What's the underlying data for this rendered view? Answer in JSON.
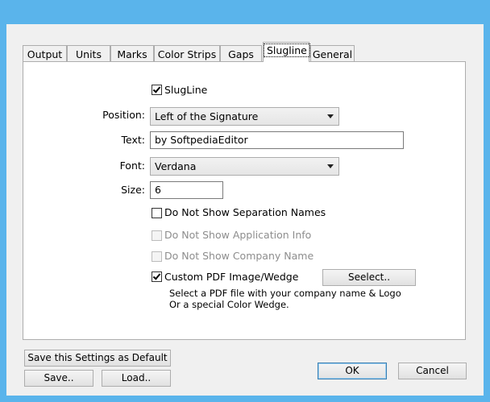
{
  "tabs": [
    {
      "label": "Output",
      "active": false
    },
    {
      "label": "Units",
      "active": false
    },
    {
      "label": "Marks",
      "active": false
    },
    {
      "label": "Color Strips",
      "active": false
    },
    {
      "label": "Gaps",
      "active": false
    },
    {
      "label": "Slugline",
      "active": true
    },
    {
      "label": "General",
      "active": false
    }
  ],
  "slugline": {
    "enable_label": "SlugLine",
    "enable_checked": true,
    "position_label": "Position:",
    "position_value": "Left of the Signature",
    "text_label": "Text:",
    "text_value": "by SoftpediaEditor",
    "font_label": "Font:",
    "font_value": "Verdana",
    "size_label": "Size:",
    "size_value": "6",
    "no_sep_names_label": "Do Not Show Separation Names",
    "no_sep_names_checked": false,
    "no_app_info_label": "Do Not Show Application Info",
    "no_app_info_checked": false,
    "no_company_label": "Do Not Show Company Name",
    "no_company_checked": false,
    "custom_pdf_label": "Custom PDF Image/Wedge",
    "custom_pdf_checked": true,
    "select_button": "Seelect..",
    "hint_line1": "Select a PDF file with your company name & Logo",
    "hint_line2": "Or a special Color Wedge."
  },
  "footer": {
    "save_default": "Save this Settings as Default",
    "save": "Save..",
    "load": "Load..",
    "ok": "OK",
    "cancel": "Cancel"
  },
  "colors": {
    "window_frame": "#5ab4eb",
    "dialog_bg": "#f0f0f0",
    "panel_bg": "#ffffff",
    "default_button_border": "#3c7fb1"
  }
}
